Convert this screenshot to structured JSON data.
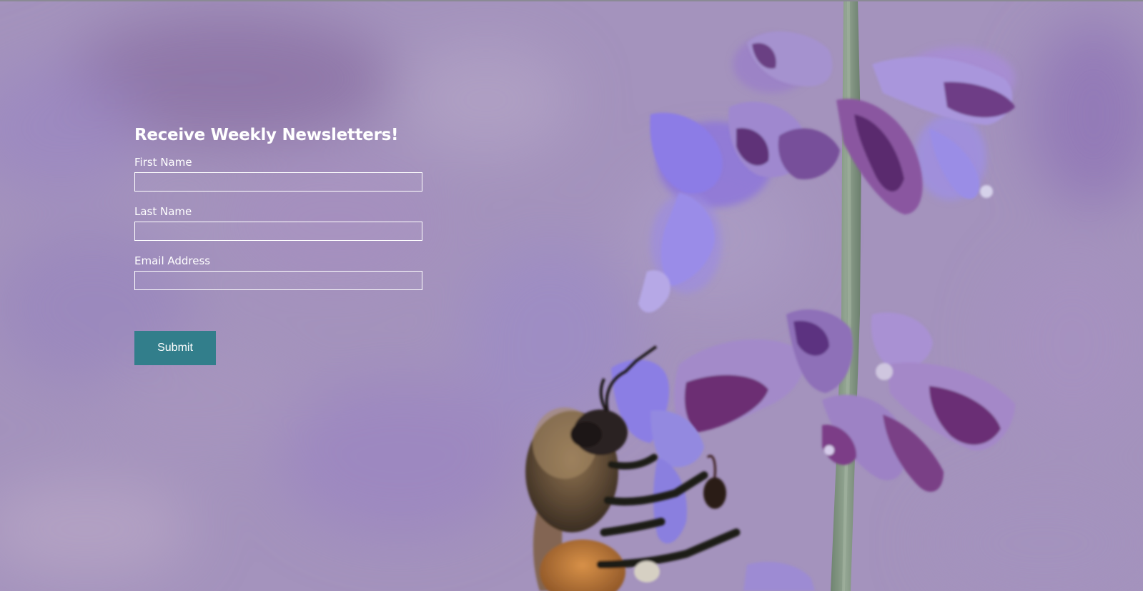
{
  "newsletter": {
    "title": "Receive Weekly Newsletters!",
    "fields": [
      {
        "label": "First Name",
        "value": "",
        "placeholder": ""
      },
      {
        "label": "Last Name",
        "value": "",
        "placeholder": ""
      },
      {
        "label": "Email Address",
        "value": "",
        "placeholder": ""
      }
    ],
    "submit_label": "Submit"
  },
  "colors": {
    "background": "#a896c0",
    "button": "#327e8b",
    "text": "#ffffff"
  },
  "background_image": {
    "subject": "honeybee on lavender sage flower",
    "icon": "bee-on-flower-photo"
  }
}
